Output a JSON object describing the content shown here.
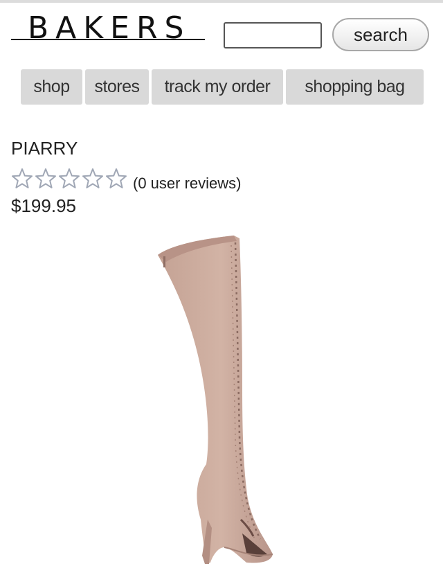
{
  "header": {
    "logo_text": "BAKERS",
    "search_placeholder": "",
    "search_button": "search"
  },
  "nav": {
    "items": [
      {
        "label": "shop"
      },
      {
        "label": "stores"
      },
      {
        "label": "track my order"
      },
      {
        "label": "shopping bag"
      }
    ]
  },
  "product": {
    "name": "PIARRY",
    "rating": 0,
    "rating_max": 5,
    "reviews_label": "(0 user reviews)",
    "price": "$199.95",
    "image_icon": "thigh-high-lace-up-boot",
    "boot_color": "#c9a99a"
  },
  "theme": {
    "nav_bg": "#d9d9d9",
    "star_outline": "#a0a7b5"
  }
}
